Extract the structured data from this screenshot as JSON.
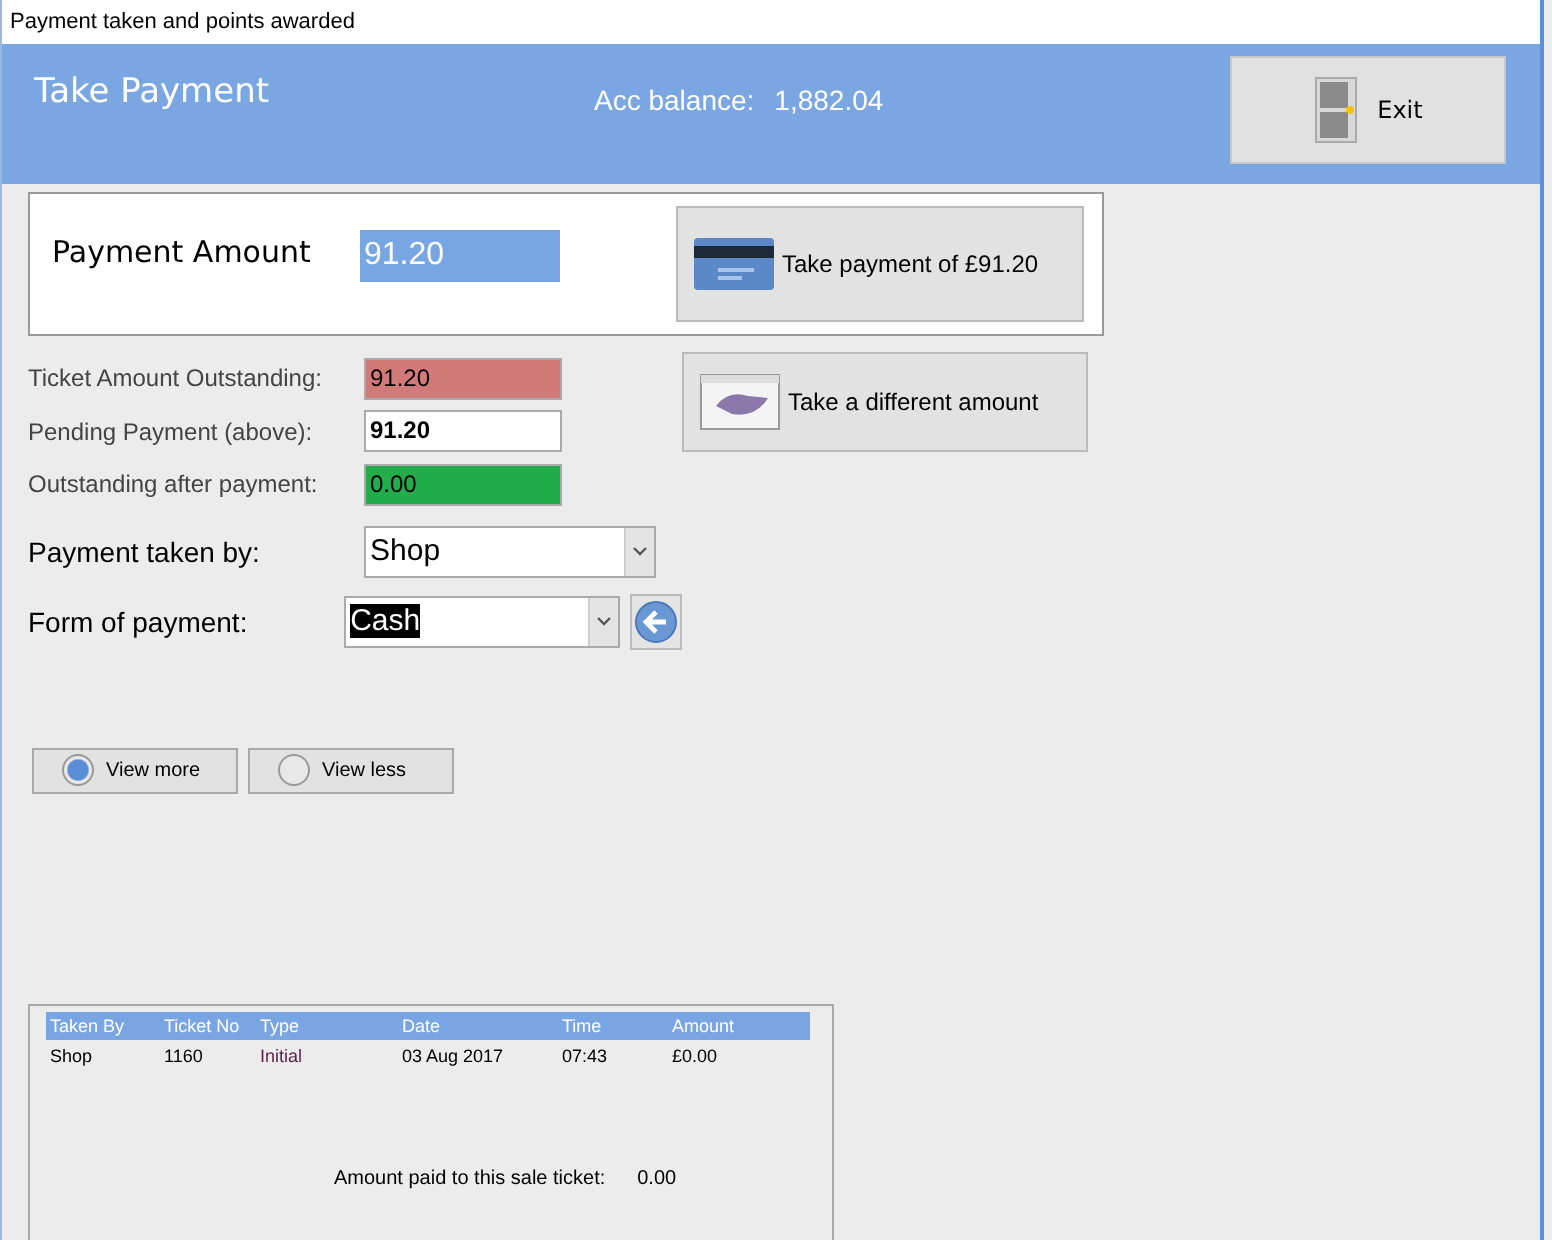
{
  "window": {
    "title": "Payment taken and points awarded"
  },
  "header": {
    "title": "Take Payment",
    "balance_label": "Acc balance:",
    "balance_value": "1,882.04",
    "exit_button": "Exit"
  },
  "payment": {
    "label": "Payment Amount",
    "value": "91.20",
    "button": "Take payment of £91.20"
  },
  "summary": [
    {
      "label": "Ticket Amount Outstanding:",
      "value": "91.20",
      "color": "#d27a78",
      "bold": false
    },
    {
      "label": "Pending Payment (above):",
      "value": "91.20",
      "color": "#ffffff",
      "bold": true
    },
    {
      "label": "Outstanding after payment:",
      "value": "0.00",
      "color": "#22ac4a",
      "bold": false
    }
  ],
  "different_amount_button": "Take a different amount",
  "dropdowns": [
    {
      "label": "Payment taken by:",
      "value": "Shop",
      "text_selected": false,
      "back_button": false
    },
    {
      "label": "Form of payment:",
      "value": "Cash",
      "text_selected": true,
      "back_button": true
    }
  ],
  "view_options": [
    {
      "label": "View more",
      "selected": true
    },
    {
      "label": "View less",
      "selected": false
    }
  ],
  "table": {
    "columns": [
      "Taken By",
      "Ticket No",
      "Type",
      "Date",
      "Time",
      "Amount"
    ],
    "rows": [
      [
        "Shop",
        "1160",
        "Initial",
        "03 Aug 2017",
        "07:43",
        "£0.00"
      ]
    ],
    "total_label": "Amount paid to this sale ticket:",
    "total_value": "0.00"
  }
}
